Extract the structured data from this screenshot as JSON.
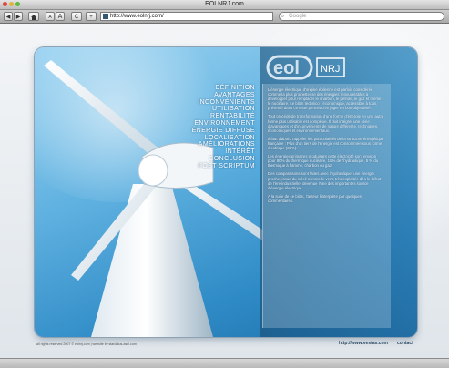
{
  "window": {
    "title": "EOLNRJ.com"
  },
  "toolbar": {
    "back_label": "◀",
    "forward_label": "▶",
    "home_icon": "home-icon",
    "text_small_label": "A",
    "text_large_label": "A",
    "reload_label": "C",
    "add_label": "+",
    "url_value": "http://www.eolnrj.com/",
    "search_placeholder": "Google"
  },
  "logo": {
    "brand": "eol",
    "suffix": "NRJ"
  },
  "menu": [
    "Définition",
    "Avantages",
    "Inconvénients",
    "Utilisation",
    "Rentabilité",
    "Environnement",
    "Énergie diffuse",
    "Localisation",
    "Améliorations",
    "Intérêt",
    "Conclusion",
    "Post scriptum"
  ],
  "article": [
    "L'énergie électrique d'origine éolienne est parfois considérée comme la plus prometteuse des énergies renouvelables à développer pour remplacer le charbon, le pétrole, le gaz et même le nucléaire. Le bilan technico - économique, accessible à tous, présenté dans ce texte permet d'en juger en bon objectivité.",
    "Tout procédé de transformation d'une forme d'énergie en une autre forme plus utilisable est complexe. Il doit intégrer une série d'avantages et d'inconvénients de nature différente, techniques, économiques et environnementaux.",
    "Il faut d'abord rappeler les particularités de la structure énergétique française : Plus d'un tiers de l'énergie est consommée sous forme électrique (38%).",
    "Les énergies primaires produisant cette électricité sont environ pour 80% du thermique nucléaire, 15% de l'hydraulique, 5 % du thermique à flamme, charbon ou gaz.",
    "Des comparaisons sont faites avec l'hydraulique, une énergie proche, issue du soleil comme le vent, très exploitée dès le début de l'ère industrielle, devenue l'une des importantes source d'énergie électrique.",
    "A la suite de ce bilan, l'auteur l'interprète par quelques commentaires."
  ],
  "footer": {
    "rights": "all rights reserved 2007 © eolnrj.com  |  website by stardatus-asel.com",
    "site_link": "http://www.vestas.com",
    "contact_link": "contact"
  },
  "colors": {
    "sky_light": "#9dd4f2",
    "sky_deep": "#1e6fa8",
    "menu_text": "#ffffff"
  }
}
